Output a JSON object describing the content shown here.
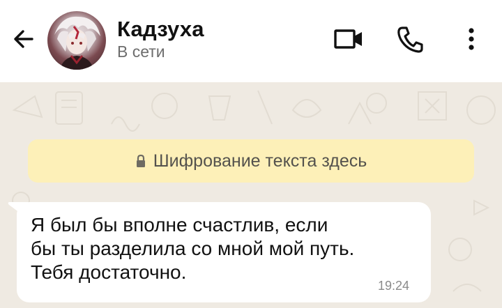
{
  "header": {
    "contact_name": "Кадзуха",
    "status": "В сети",
    "back_icon": "arrow-left-icon",
    "video_icon": "video-camera-icon",
    "call_icon": "phone-icon",
    "menu_icon": "more-vertical-icon"
  },
  "chat": {
    "system_message": {
      "icon": "lock-icon",
      "text": "Шифрование текста здесь"
    },
    "messages": [
      {
        "direction": "incoming",
        "text": "Я был бы вполне счастлив, если\nбы ты разделила со мной мой путь.\nТебя достаточно.",
        "time": "19:24"
      }
    ]
  },
  "colors": {
    "header_background": "#ffffff",
    "chat_background": "#efeae2",
    "system_banner": "#fdf0b8",
    "incoming_bubble": "#ffffff"
  }
}
